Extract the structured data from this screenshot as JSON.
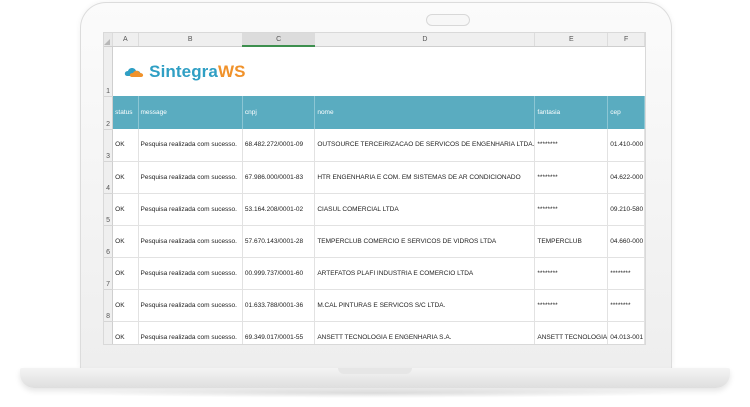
{
  "logo": {
    "part1": "Sintegra",
    "part2": "WS"
  },
  "columns": [
    "A",
    "B",
    "C",
    "D",
    "E",
    "F"
  ],
  "row_numbers": [
    "1",
    "2",
    "3",
    "4",
    "5",
    "6",
    "7",
    "8"
  ],
  "headers": [
    "status",
    "message",
    "cnpj",
    "nome",
    "fantasia",
    "cep"
  ],
  "rows": [
    [
      "OK",
      "Pesquisa realizada com sucesso.",
      "68.482.272/0001-09",
      "OUTSOURCE TERCEIRIZACAO DE SERVICOS DE ENGENHARIA LTDA.",
      "********",
      "01.410-000"
    ],
    [
      "OK",
      "Pesquisa realizada com sucesso.",
      "67.986.000/0001-83",
      "HTR ENGENHARIA E COM. EM SISTEMAS DE AR CONDICIONADO",
      "********",
      "04.622-000"
    ],
    [
      "OK",
      "Pesquisa realizada com sucesso.",
      "53.164.208/0001-02",
      "CIASUL COMERCIAL LTDA",
      "********",
      "09.210-580"
    ],
    [
      "OK",
      "Pesquisa realizada com sucesso.",
      "57.670.143/0001-28",
      "TEMPERCLUB COMERCIO E SERVICOS DE VIDROS LTDA",
      "TEMPERCLUB",
      "04.660-000"
    ],
    [
      "OK",
      "Pesquisa realizada com sucesso.",
      "00.999.737/0001-60",
      "ARTEFATOS PLAFI INDUSTRIA E COMERCIO LTDA",
      "********",
      "********"
    ],
    [
      "OK",
      "Pesquisa realizada com sucesso.",
      "01.633.788/0001-36",
      "M.CAL PINTURAS E SERVICOS S/C LTDA.",
      "********",
      "********"
    ],
    [
      "OK",
      "Pesquisa realizada com sucesso.",
      "69.349.017/0001-55",
      "ANSETT TECNOLOGIA E ENGENHARIA S.A.",
      "ANSETT TECNOLOGIA",
      "04.013-001"
    ]
  ],
  "colors": {
    "header_bg": "#5aacc0",
    "logo_blue": "#2f9fc4",
    "logo_orange": "#f0922b",
    "selected_column_accent": "#3d8f4e"
  },
  "selected_column": "C"
}
